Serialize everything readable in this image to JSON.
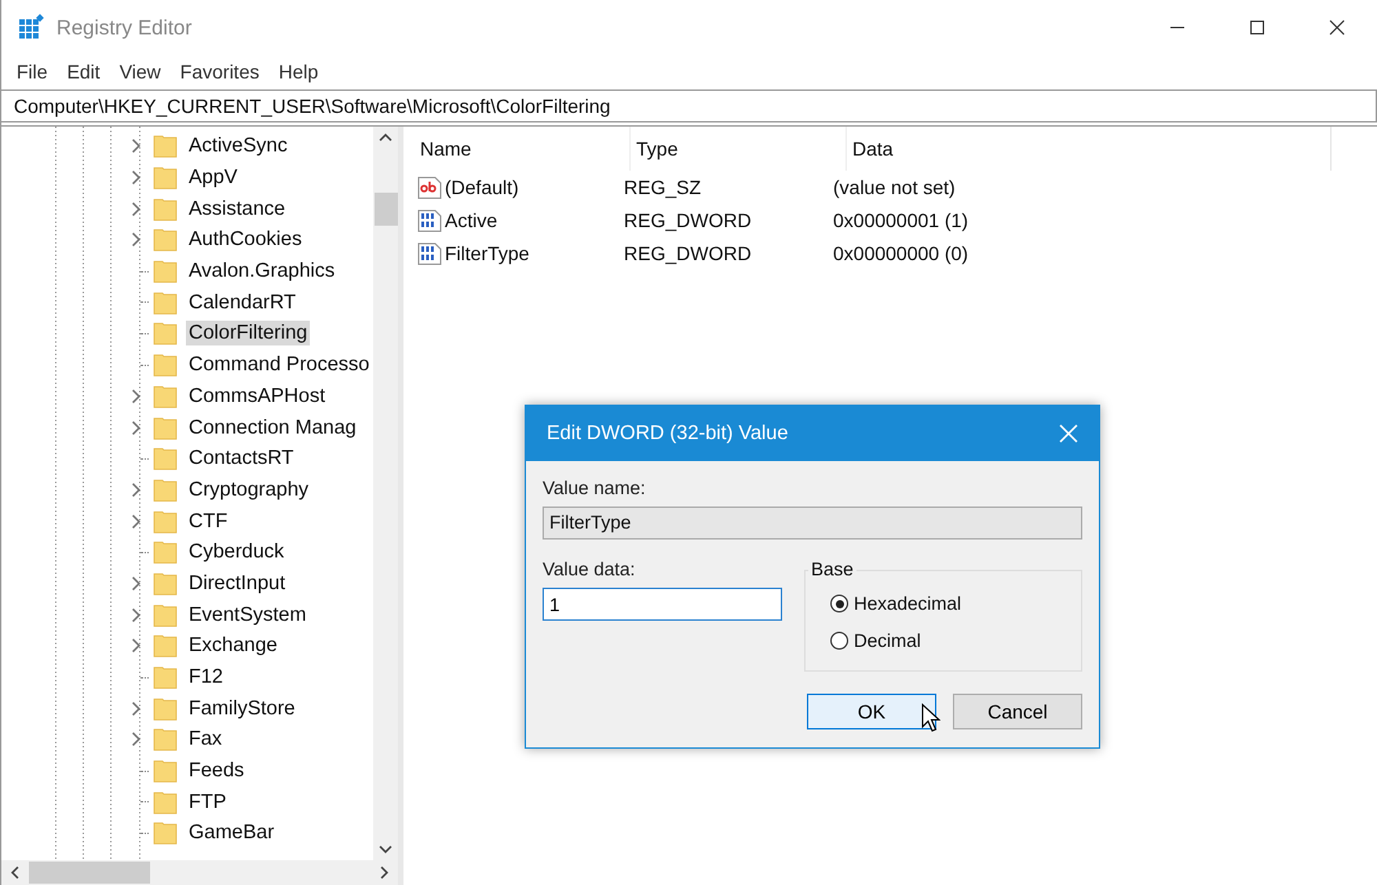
{
  "window": {
    "title": "Registry Editor"
  },
  "menu": [
    "File",
    "Edit",
    "View",
    "Favorites",
    "Help"
  ],
  "address": "Computer\\HKEY_CURRENT_USER\\Software\\Microsoft\\ColorFiltering",
  "tree": {
    "items": [
      {
        "label": "ActiveSync",
        "expandable": true,
        "selected": false
      },
      {
        "label": "AppV",
        "expandable": true,
        "selected": false
      },
      {
        "label": "Assistance",
        "expandable": true,
        "selected": false
      },
      {
        "label": "AuthCookies",
        "expandable": true,
        "selected": false
      },
      {
        "label": "Avalon.Graphics",
        "expandable": false,
        "selected": false
      },
      {
        "label": "CalendarRT",
        "expandable": false,
        "selected": false
      },
      {
        "label": "ColorFiltering",
        "expandable": false,
        "selected": true
      },
      {
        "label": "Command Processo",
        "expandable": false,
        "selected": false
      },
      {
        "label": "CommsAPHost",
        "expandable": true,
        "selected": false
      },
      {
        "label": "Connection Manag",
        "expandable": true,
        "selected": false
      },
      {
        "label": "ContactsRT",
        "expandable": false,
        "selected": false
      },
      {
        "label": "Cryptography",
        "expandable": true,
        "selected": false
      },
      {
        "label": "CTF",
        "expandable": true,
        "selected": false
      },
      {
        "label": "Cyberduck",
        "expandable": false,
        "selected": false
      },
      {
        "label": "DirectInput",
        "expandable": true,
        "selected": false
      },
      {
        "label": "EventSystem",
        "expandable": true,
        "selected": false
      },
      {
        "label": "Exchange",
        "expandable": true,
        "selected": false
      },
      {
        "label": "F12",
        "expandable": false,
        "selected": false
      },
      {
        "label": "FamilyStore",
        "expandable": true,
        "selected": false
      },
      {
        "label": "Fax",
        "expandable": true,
        "selected": false
      },
      {
        "label": "Feeds",
        "expandable": false,
        "selected": false
      },
      {
        "label": "FTP",
        "expandable": false,
        "selected": false
      },
      {
        "label": "GameBar",
        "expandable": false,
        "selected": false
      }
    ]
  },
  "values": {
    "columns": [
      "Name",
      "Type",
      "Data"
    ],
    "rows": [
      {
        "kind": "string",
        "name": "(Default)",
        "type": "REG_SZ",
        "data": "(value not set)"
      },
      {
        "kind": "binary",
        "name": "Active",
        "type": "REG_DWORD",
        "data": "0x00000001 (1)"
      },
      {
        "kind": "binary",
        "name": "FilterType",
        "type": "REG_DWORD",
        "data": "0x00000000 (0)"
      }
    ]
  },
  "dialog": {
    "title": "Edit DWORD (32-bit) Value",
    "value_name_label": "Value name:",
    "value_name": "FilterType",
    "value_data_label": "Value data:",
    "value_data": "1",
    "base_label": "Base",
    "bases": [
      {
        "label": "Hexadecimal",
        "selected": true
      },
      {
        "label": "Decimal",
        "selected": false
      }
    ],
    "buttons": [
      {
        "label": "OK",
        "hovered": true
      },
      {
        "label": "Cancel",
        "hovered": false
      }
    ]
  }
}
